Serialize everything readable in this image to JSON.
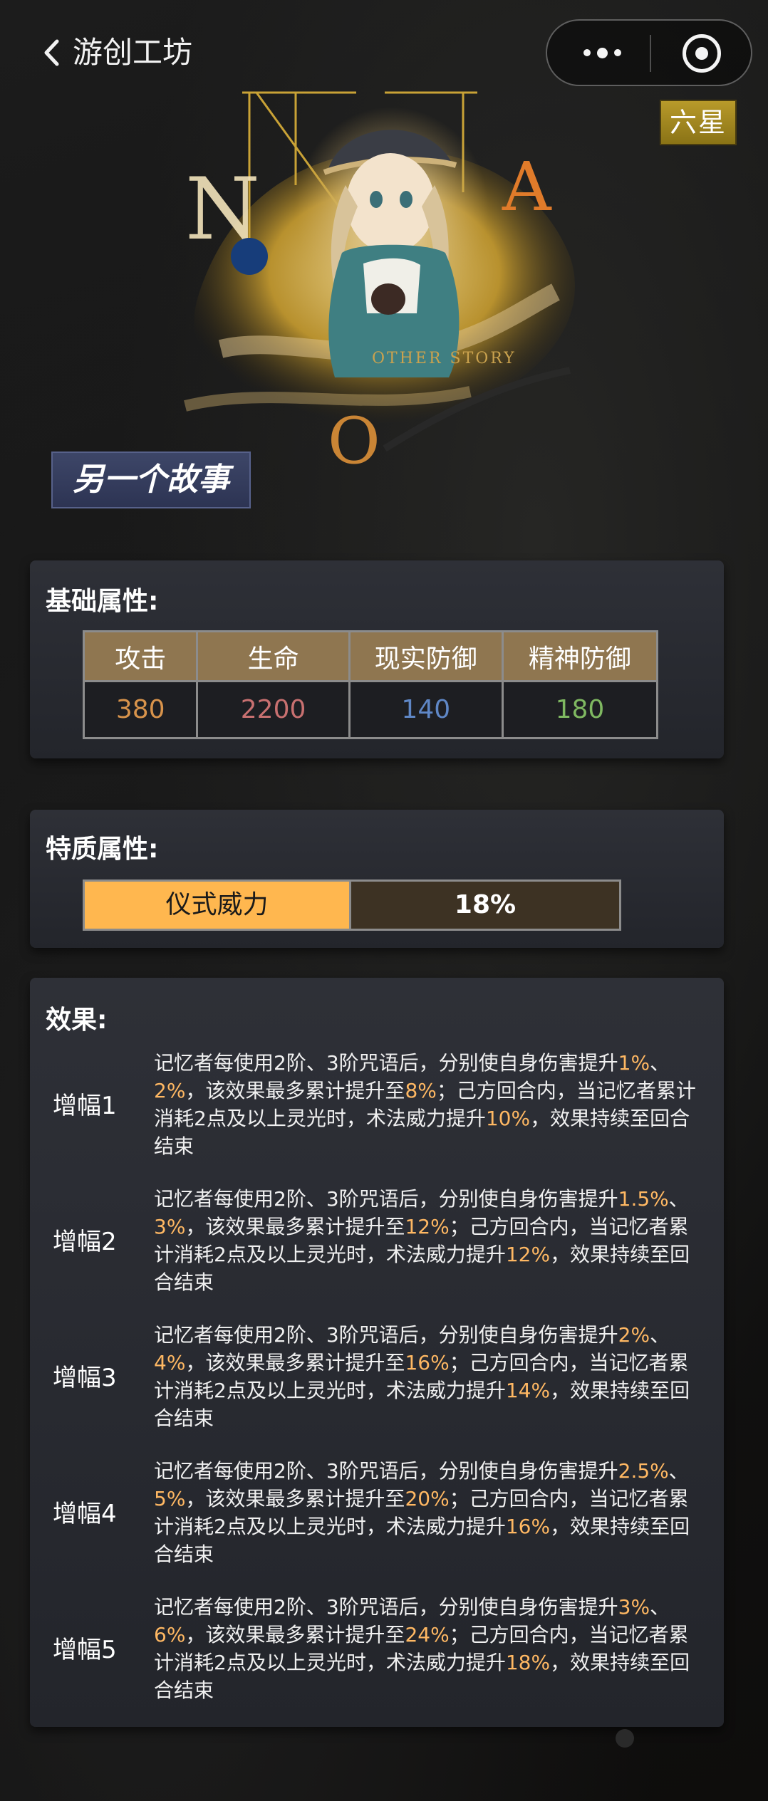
{
  "header": {
    "title": "游创工坊",
    "back_icon": "chevron-left-icon",
    "more_icon": "more-dots-icon",
    "close_icon": "target-circle-icon"
  },
  "card": {
    "rarity": "六星",
    "name": "另一个故事",
    "art_text_main": "OTHER STORY",
    "art_letters": [
      "N",
      "A",
      "O"
    ]
  },
  "base_stats": {
    "title": "基础属性:",
    "headers": [
      "攻击",
      "生命",
      "现实防御",
      "精神防御"
    ],
    "values": [
      "380",
      "2200",
      "140",
      "180"
    ],
    "value_colors": [
      "#d8934b",
      "#c87070",
      "#5f87c6",
      "#7fb861"
    ]
  },
  "special_attr": {
    "title": "特质属性:",
    "name": "仪式威力",
    "value": "18%"
  },
  "effects": {
    "title": "效果:",
    "items": [
      {
        "label": "增幅1",
        "parts": [
          "记忆者每使用2阶、3阶咒语后，分别使自身伤害提升",
          "1%",
          "、",
          "2%",
          "，该效果最多累计提升至",
          "8%",
          "；己方回合内，当记忆者累计消耗2点及以上灵光时，术法威力提升",
          "10%",
          "，效果持续至回合结束"
        ]
      },
      {
        "label": "增幅2",
        "parts": [
          "记忆者每使用2阶、3阶咒语后，分别使自身伤害提升",
          "1.5%",
          "、",
          "3%",
          "，该效果最多累计提升至",
          "12%",
          "；己方回合内，当记忆者累计消耗2点及以上灵光时，术法威力提升",
          "12%",
          "，效果持续至回合结束"
        ]
      },
      {
        "label": "增幅3",
        "parts": [
          "记忆者每使用2阶、3阶咒语后，分别使自身伤害提升",
          "2%",
          "、",
          "4%",
          "，该效果最多累计提升至",
          "16%",
          "；己方回合内，当记忆者累计消耗2点及以上灵光时，术法威力提升",
          "14%",
          "，效果持续至回合结束"
        ]
      },
      {
        "label": "增幅4",
        "parts": [
          "记忆者每使用2阶、3阶咒语后，分别使自身伤害提升",
          "2.5%",
          "、",
          "5%",
          "，该效果最多累计提升至",
          "20%",
          "；己方回合内，当记忆者累计消耗2点及以上灵光时，术法威力提升",
          "16%",
          "，效果持续至回合结束"
        ]
      },
      {
        "label": "增幅5",
        "parts": [
          "记忆者每使用2阶、3阶咒语后，分别使自身伤害提升",
          "3%",
          "、",
          "6%",
          "，该效果最多累计提升至",
          "24%",
          "；己方回合内，当记忆者累计消耗2点及以上灵光时，术法威力提升",
          "18%",
          "，效果持续至回合结束"
        ]
      }
    ]
  }
}
